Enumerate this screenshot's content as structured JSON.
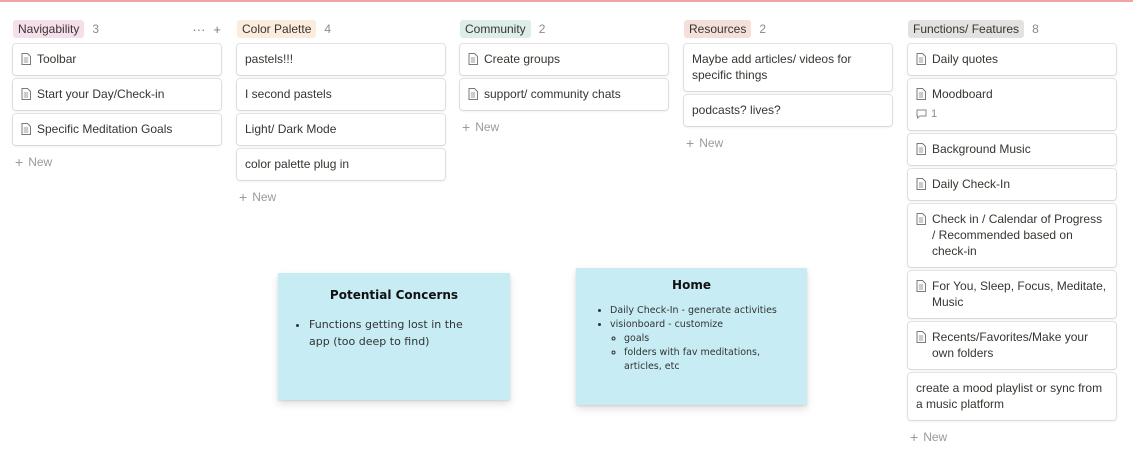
{
  "columns": [
    {
      "label": "Navigability",
      "count": "3",
      "tag_color": "#f4dfeb",
      "cards": [
        "Toolbar",
        "Start your Day/Check-in",
        "Specific Meditation Goals"
      ],
      "new_label": "New"
    },
    {
      "label": "Color Palette",
      "count": "4",
      "tag_color": "#fbecdd",
      "cards": [
        "pastels!!!",
        "I second pastels",
        "Light/ Dark Mode",
        "color palette plug in"
      ],
      "new_label": "New"
    },
    {
      "label": "Community",
      "count": "2",
      "tag_color": "#ddedea",
      "cards": [
        "Create groups",
        "support/ community chats"
      ],
      "new_label": "New"
    },
    {
      "label": "Resources",
      "count": "2",
      "tag_color": "#f4dfdb",
      "cards": [
        "Maybe add articles/ videos for specific things",
        "podcasts? lives?"
      ],
      "new_label": "New"
    },
    {
      "label": "Functions/ Features",
      "count": "8",
      "tag_color": "#e3e2e0",
      "cards": [
        "Daily quotes",
        "Moodboard",
        "Background Music",
        "Daily Check-In",
        "Check in / Calendar of Progress / Recommended based on check-in",
        "For You, Sleep, Focus, Meditate, Music",
        "Recents/Favorites/Make your own folders",
        "create a mood playlist or sync from a music platform"
      ],
      "moodboard_comments": "1",
      "new_label": "New"
    }
  ],
  "header_actions": {
    "more": "···",
    "add": "+"
  },
  "stickies": {
    "concerns": {
      "title": "Potential Concerns",
      "items": [
        "Functions getting lost in the app (too deep to find)"
      ]
    },
    "home": {
      "title": "Home",
      "items": [
        "Daily Check-In - generate activities",
        "visionboard - customize"
      ],
      "subitems": [
        "goals",
        "folders with fav meditations, articles, etc"
      ]
    }
  },
  "colors": {
    "sticky": "#c7ecf4",
    "accent_top": "#f2a3a3"
  }
}
